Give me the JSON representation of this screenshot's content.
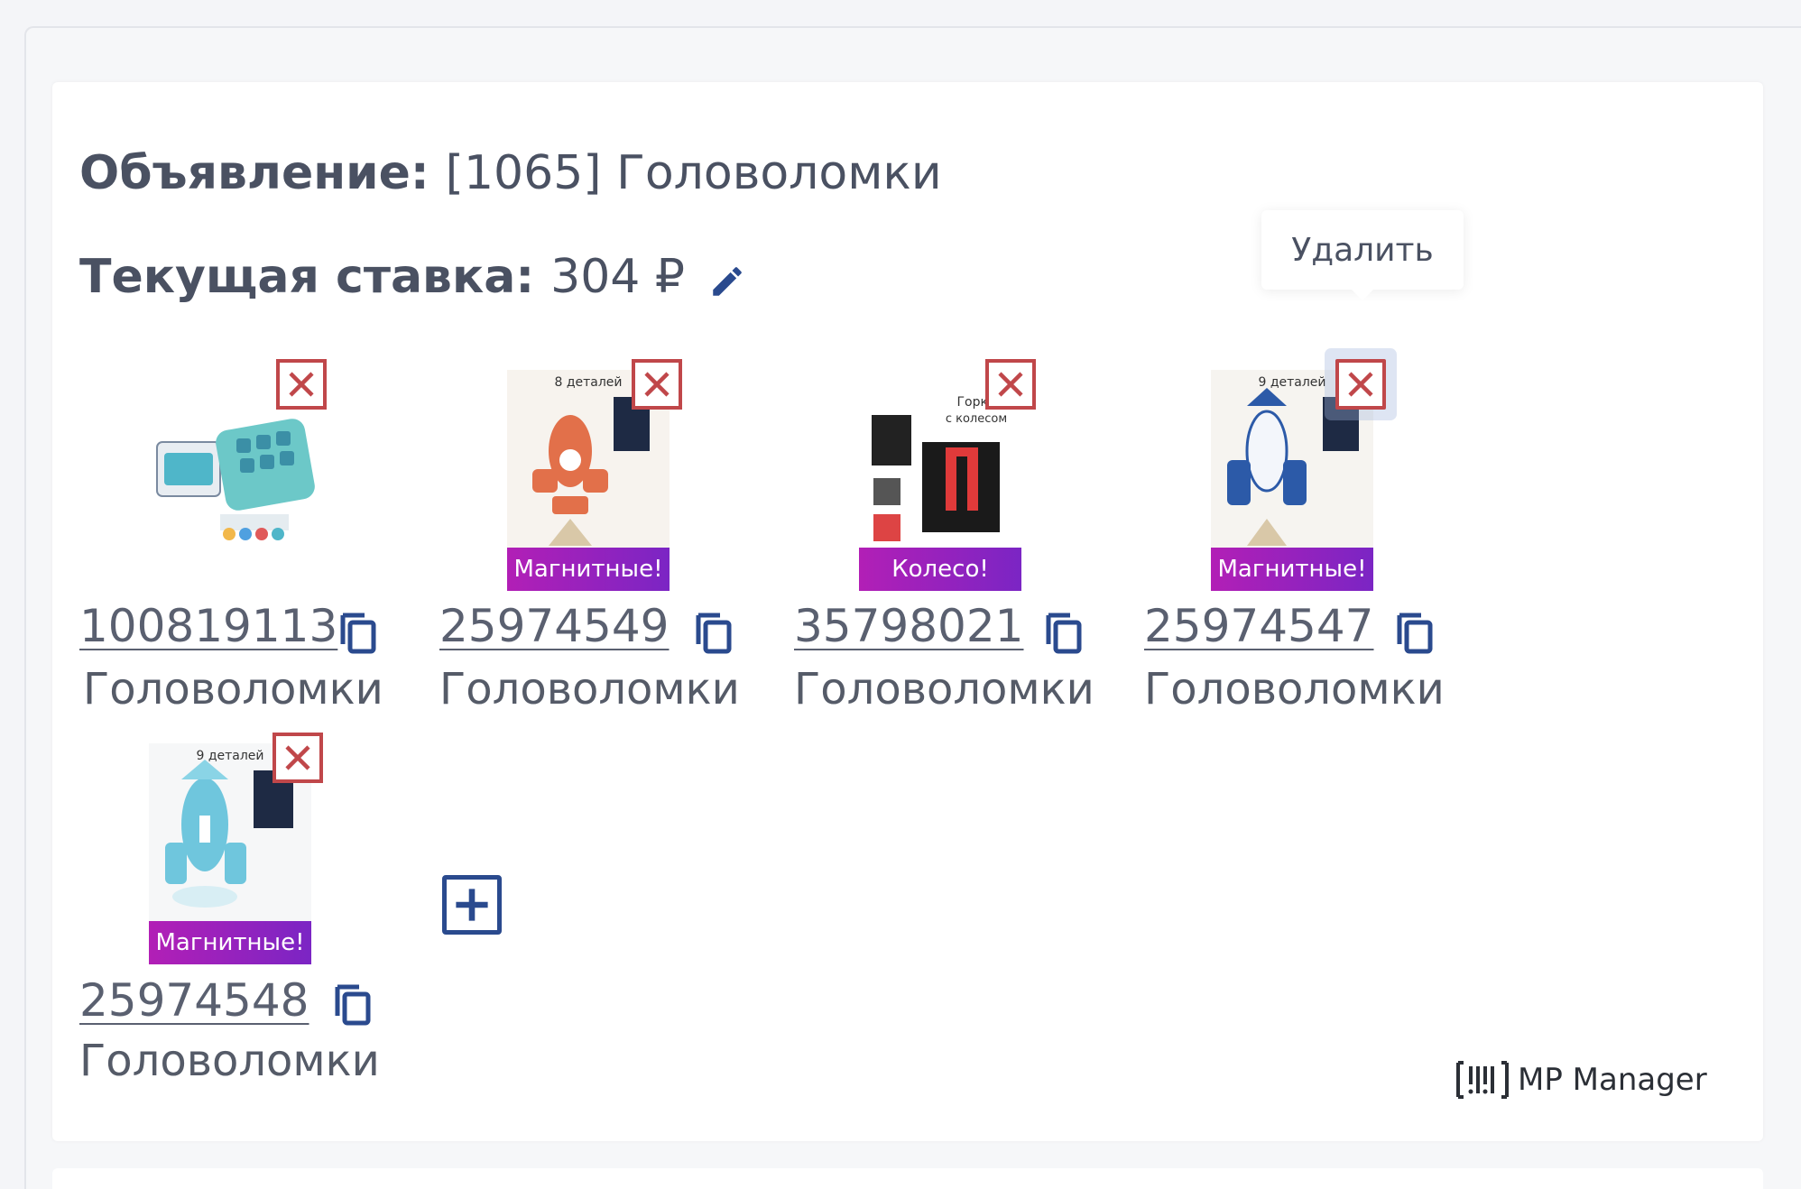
{
  "ad": {
    "label": "Объявление:",
    "value": "[1065] Головоломки"
  },
  "bid": {
    "label": "Текущая ставка:",
    "value": "304 ₽"
  },
  "tooltip": {
    "text": "Удалить"
  },
  "products": [
    {
      "id": "100819113",
      "category": "Головоломки",
      "badge": ""
    },
    {
      "id": "25974549",
      "category": "Головоломки",
      "badge": "Магнитные!"
    },
    {
      "id": "35798021",
      "category": "Головоломки",
      "badge": "Колесо!"
    },
    {
      "id": "25974547",
      "category": "Головоломки",
      "badge": "Магнитные!"
    },
    {
      "id": "25974548",
      "category": "Головоломки",
      "badge": "Магнитные!"
    }
  ],
  "brand": {
    "name": "MP Manager"
  },
  "colors": {
    "accent": "#2a4a8e",
    "delete": "#c0474a",
    "badge": "#a020b8"
  },
  "icons": {
    "edit": "pencil-icon",
    "delete": "close-icon",
    "copy": "copy-icon",
    "add": "plus-icon",
    "brand": "barcode-icon"
  }
}
